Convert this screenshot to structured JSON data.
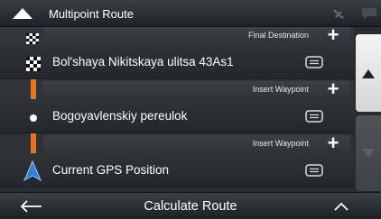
{
  "header": {
    "title": "Multipoint Route",
    "icons": [
      "up-arrow-icon",
      "satellite-icon",
      "chat-icon"
    ]
  },
  "waypoints": [
    {
      "insert_label": "Final Destination",
      "label": "Bol'shaya Nikitskaya ulitsa 43As1",
      "marker": "checkered-flag-icon"
    },
    {
      "insert_label": "Insert Waypoint",
      "label": "Bogoyavlenskiy pereulok",
      "marker": "waypoint-dot-icon"
    },
    {
      "insert_label": "Insert Waypoint",
      "label": "Current GPS Position",
      "marker": "gps-arrow-icon"
    }
  ],
  "footer": {
    "calculate_label": "Calculate Route"
  },
  "colors": {
    "route_line": "#e8741e",
    "gps_arrow": "#2f7fd6"
  }
}
